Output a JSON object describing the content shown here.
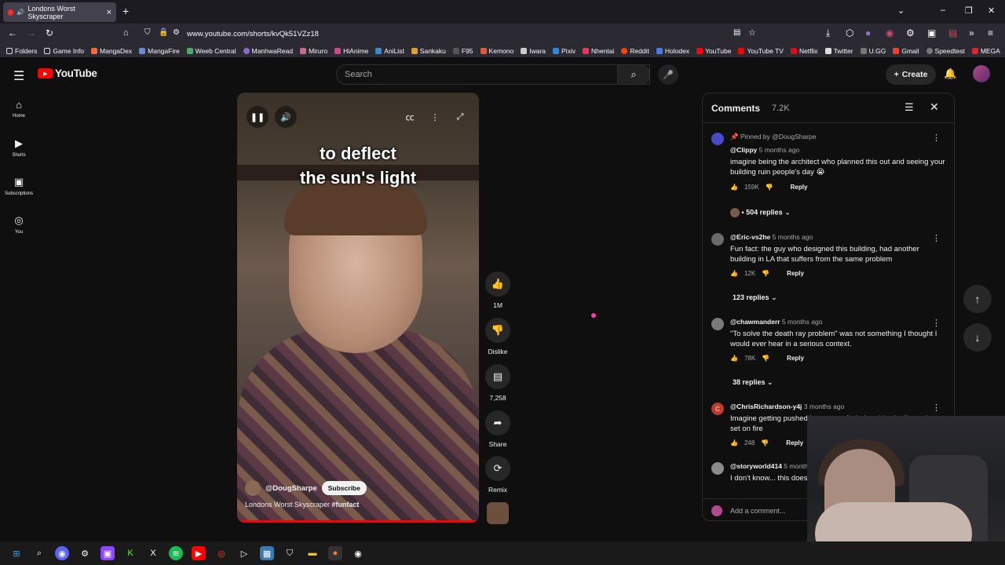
{
  "browser": {
    "tab_title": "Londons Worst Skyscraper",
    "url": "www.youtube.com/shorts/kvQk51VZz18",
    "bookmarks": [
      "Folders",
      "Game Info",
      "MangaDex",
      "MangaFire",
      "Weeb Central",
      "ManhwaRead",
      "Miruro",
      "HiAnime",
      "AniList",
      "Sankaku",
      "F95",
      "Kemono",
      "Iwara",
      "Pixiv",
      "Nhentai",
      "Reddit",
      "Holodex",
      "YouTube",
      "YouTube TV",
      "Netflix",
      "Twitter",
      "U.GG",
      "Gmail",
      "Speedtest",
      "MEGA"
    ]
  },
  "youtube": {
    "logo": "YouTube",
    "search_placeholder": "Search",
    "create_label": "Create",
    "sidebar": [
      {
        "label": "Home",
        "icon": "home-icon"
      },
      {
        "label": "Shorts",
        "icon": "shorts-icon"
      },
      {
        "label": "Subscriptions",
        "icon": "subscriptions-icon"
      },
      {
        "label": "You",
        "icon": "you-icon"
      }
    ]
  },
  "video": {
    "caption_line1": "to deflect",
    "caption_line2": "the sun's light",
    "channel": "@DougSharpe",
    "subscribe_label": "Subscribe",
    "title": "Londons Worst Skyscraper",
    "hashtag": "#funfact",
    "progress": 0.99,
    "likes": "1M",
    "dislike_label": "Dislike",
    "comments_count": "7,258",
    "share_label": "Share",
    "remix_label": "Remix"
  },
  "comments": {
    "title": "Comments",
    "count": "7.2K",
    "add_placeholder": "Add a comment...",
    "items": [
      {
        "pinned": "Pinned by @DougSharpe",
        "author": "@Clippy",
        "time": "5 months ago",
        "text": "imagine being the architect who planned this out and seeing your building ruin people's day 😭",
        "likes": "159K",
        "replies": "504 replies",
        "reply_label": "Reply",
        "avatar_color": "#4a4ac8"
      },
      {
        "author": "@Eric-vs2he",
        "time": "5 months ago",
        "text": "Fun fact: the guy who designed this building, had another building in LA that suffers from the same problem",
        "likes": "12K",
        "replies": "123 replies",
        "reply_label": "Reply",
        "avatar_color": "#6b6b6b"
      },
      {
        "author": "@chawmanderr",
        "time": "5 months ago",
        "text": "\"To solve the death ray problem\" was not something I thought I would ever hear in a serious context.",
        "likes": "78K",
        "replies": "38 replies",
        "reply_label": "Reply",
        "avatar_color": "#7a7a7a"
      },
      {
        "author": "@ChrisRichardson-y4j",
        "time": "3 months ago",
        "text": "Imagine getting pushed by a gust of wind and basically getting set on fire",
        "likes": "248",
        "reply_label": "Reply",
        "avatar_color": "#c0392b",
        "avatar_letter": "C"
      },
      {
        "author": "@storyworld414",
        "time": "5 months ago",
        "text": "I don't know... this does sound like the building wanted to kill.",
        "likes": "",
        "reply_label": "Reply",
        "avatar_color": "#8a8a8a"
      }
    ]
  }
}
